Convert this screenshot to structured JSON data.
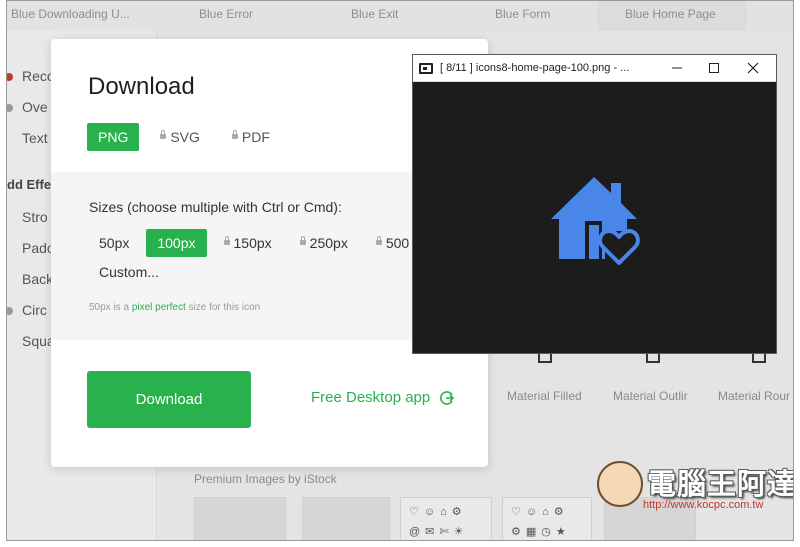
{
  "background": {
    "top_items": [
      "Blue Downloading U...",
      "Blue Error",
      "Blue Exit",
      "Blue Form",
      "Blue Home Page"
    ],
    "left_items": [
      "Reco",
      "Ove",
      "Text",
      "Stro",
      "Pado",
      "Back",
      "Circ",
      "Squa"
    ],
    "left_heading": "dd Effe",
    "style_labels": [
      "Material Filled",
      "Material Outlir",
      "Material Rour"
    ],
    "premium_label": "Premium Images by iStock"
  },
  "dialog": {
    "title": "Download",
    "formats": [
      "PNG",
      "SVG",
      "PDF"
    ],
    "sizes_heading": "Sizes (choose multiple with Ctrl or Cmd):",
    "sizes": [
      "50px",
      "100px",
      "150px",
      "250px",
      "500"
    ],
    "custom_label": "Custom...",
    "note_prefix": "50px is a ",
    "note_link": "pixel perfect",
    "note_suffix": " size for this icon",
    "download_label": "Download",
    "desktop_link": "Free Desktop app"
  },
  "preview_window": {
    "title": "[ 8/11 ]  icons8-home-page-100.png  - ...",
    "icon_name": "home-heart-icon",
    "icon_color": "#4a86e8",
    "background_color": "#1c1c1c"
  },
  "watermark": {
    "text": "電腦王阿達",
    "url": "http://www.kocpc.com.tw"
  },
  "colors": {
    "accent": "#28b14c"
  }
}
